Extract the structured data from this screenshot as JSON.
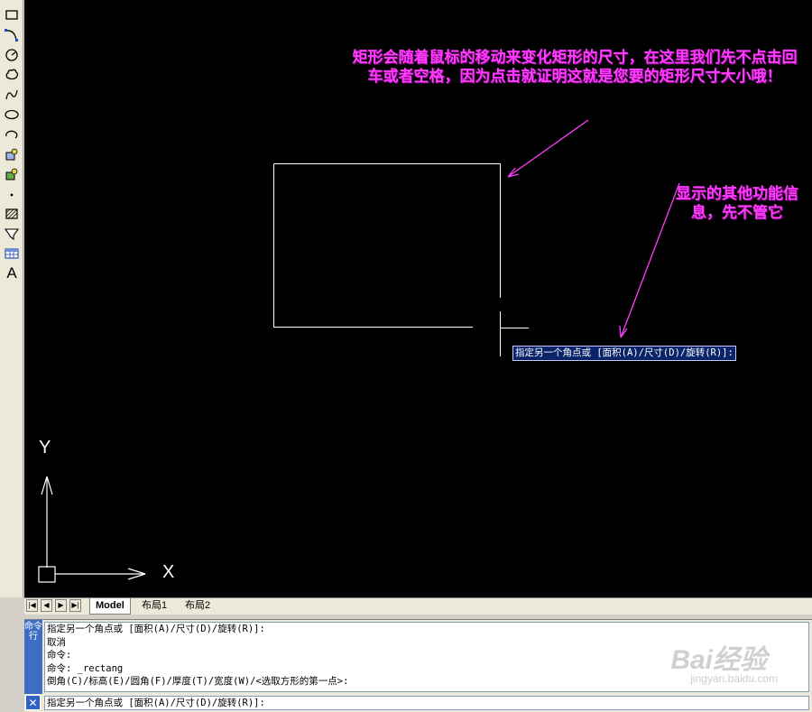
{
  "toolbar": {
    "tools": [
      "rectangle-tool-icon",
      "arc-tool-icon",
      "circle-tool-icon",
      "revcloud-tool-icon",
      "spline-tool-icon",
      "ellipse-tool-icon",
      "ellipse-arc-tool-icon",
      "insert-block-icon",
      "make-block-icon",
      "point-tool-icon",
      "hatch-tool-icon",
      "region-tool-icon",
      "table-tool-icon",
      "multiline-text-icon"
    ],
    "text_tool_label": "A"
  },
  "canvas": {
    "annotation_main": "矩形会随着鼠标的移动来变化矩形的尺寸，在这里我们先不点击回车或者空格，因为点击就证明这就是您要的矩形尺寸大小哦！",
    "annotation_side": "显示的其他功能信息，先不管它",
    "dynamic_prompt": "指定另一个角点或 [面积(A)/尺寸(D)/旋转(R)]:",
    "ucs_x_label": "X",
    "ucs_y_label": "Y",
    "colors": {
      "background": "#000000",
      "annotation": "#ff3cff",
      "geometry": "#ffffff"
    }
  },
  "tabs": {
    "nav_buttons": [
      "first-tab-button",
      "prev-tab-button",
      "next-tab-button",
      "last-tab-button"
    ],
    "nav_glyphs": [
      "|◀",
      "◀",
      "▶",
      "▶|"
    ],
    "model": "Model",
    "layout1": "布局1",
    "layout2": "布局2"
  },
  "command": {
    "title": "命令行",
    "close_glyph": "✕",
    "history": [
      "指定另一个角点或 [面积(A)/尺寸(D)/旋转(R)]:",
      "取消",
      "命令:",
      "命令: _rectang",
      "倒角(C)/标高(E)/圆角(F)/厚度(T)/宽度(W)/<选取方形的第一点>:"
    ],
    "input": "指定另一个角点或 [面积(A)/尺寸(D)/旋转(R)]:"
  },
  "watermark": {
    "brand": "Bai经验",
    "url": "jingyan.baidu.com"
  }
}
